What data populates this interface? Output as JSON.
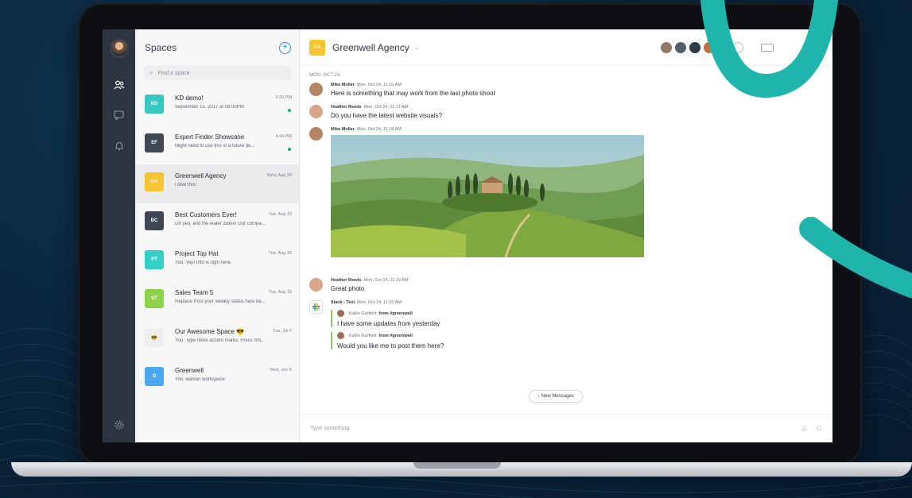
{
  "rail": {
    "icons": [
      "people-icon",
      "chat-bubble-icon",
      "bell-icon"
    ],
    "settings_icon": "gear-icon"
  },
  "spaces": {
    "title": "Spaces",
    "add_icon": "+",
    "search_placeholder": "Find a space",
    "items": [
      {
        "initials": "KD",
        "color": "#35c8c0",
        "name": "KD demo!",
        "subtitle": "September 15, 2017 at 08:00PM",
        "time": "2:20 PM",
        "unread": true,
        "selected": false
      },
      {
        "initials": "EF",
        "color": "#3f4753",
        "name": "Expert Finder Showcase",
        "subtitle": "Might need to use this in a future de...",
        "time": "4:44 PM",
        "unread": true,
        "selected": false
      },
      {
        "initials": "GA",
        "color": "#f6c531",
        "name": "Greenwell Agency",
        "subtitle": "I love this!",
        "time": "Wed, Aug 30",
        "unread": false,
        "selected": true
      },
      {
        "initials": "BC",
        "color": "#3f4753",
        "name": "Best Customers Ever!",
        "subtitle": "Oh yes, and the water slides! Our compa...",
        "time": "Tue, Aug 15",
        "unread": false,
        "selected": false
      },
      {
        "initials": "PT",
        "color": "#35d0c5",
        "name": "Project Top Hat",
        "subtitle": "You: Yep! Info is right here.",
        "time": "Tue, Aug 15",
        "unread": false,
        "selected": false
      },
      {
        "initials": "ST",
        "color": "#8cd348",
        "name": "Sales Team 5",
        "subtitle": "Replace Post your weekly status here be...",
        "time": "Tue, Aug 15",
        "unread": false,
        "selected": false
      },
      {
        "initials": "😎",
        "color": "#eeeeee",
        "name": "Our Awesome Space 😎",
        "subtitle": "You: Type three accent marks. Press Shi...",
        "time": "Tue, Jul 4",
        "unread": false,
        "selected": false
      },
      {
        "initials": "G",
        "color": "#4aa9ee",
        "name": "Greenwell",
        "subtitle": "You: watson workspace",
        "time": "Wed, Jun 5",
        "unread": false,
        "selected": false
      }
    ]
  },
  "room": {
    "initials": "GA",
    "title": "Greenwell Agency",
    "caret": "⌄",
    "participant_colors": [
      "#8f7a6a",
      "#55606c",
      "#2c3a4a",
      "#c0703b",
      "#7a5a45"
    ],
    "more": "···",
    "search_label": "Search"
  },
  "feed": {
    "date": "MON, OCT 24",
    "messages": [
      {
        "author": "Mike Moller",
        "time": "Mon, Oct 24, 11:16 AM",
        "text": "Here is something that may work from the last photo shoot",
        "avatar": "#b48564"
      },
      {
        "author": "Heather Reeds",
        "time": "Mon, Oct 24, 11:17 AM",
        "text": "Do you have the latest website visuals?",
        "avatar": "#d6a58a"
      },
      {
        "author": "Mike Moller",
        "time": "Mon, Oct 24, 11:18 AM",
        "text": "",
        "avatar": "#b48564"
      },
      {
        "author": "Heather Reeds",
        "time": "Mon, Oct 24, 11:19 AM",
        "text": "Great photo",
        "avatar": "#d6a58a"
      }
    ],
    "slack": {
      "author": "Slack - Test",
      "time": "Mon, Oct 24, 11:20 AM",
      "quotes": [
        {
          "name": "Katlin Garfield",
          "source": "from #greenwell",
          "text": "I have some updates from yesterday"
        },
        {
          "name": "Katlin Garfield",
          "source": "from #greenwell",
          "text": "Would you like me to post them here?"
        }
      ]
    },
    "new_messages": "↓ New Messages"
  },
  "composer": {
    "placeholder": "Type something"
  }
}
